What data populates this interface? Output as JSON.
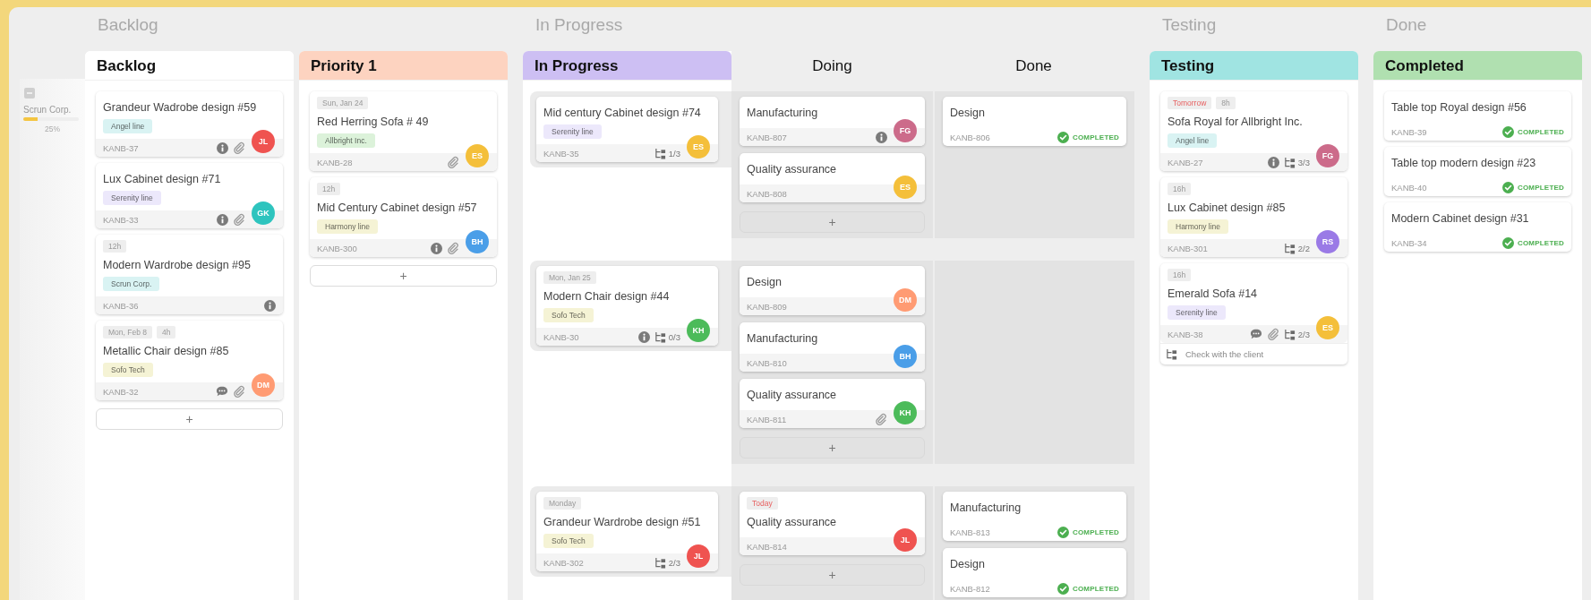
{
  "lane": {
    "title": "Scrun Corp.",
    "expanded": true,
    "level": 0.25,
    "percent": "25%"
  },
  "groups": [
    {
      "title": "Backlog",
      "kind": "columns",
      "columns": [
        {
          "title": "Backlog",
          "color": "#ffffff",
          "add": "+",
          "cards": [
            {
              "title": "Grandeur Wadrobe design #59",
              "label": {
                "text": "Angel line",
                "color": "#d9f3f3"
              },
              "id": "KANB-37",
              "info": true,
              "attachment": true,
              "avatar": {
                "initials": "JL",
                "color": "#ef5350"
              }
            },
            {
              "title": "Lux Cabinet design #71",
              "label": {
                "text": "Serenity line",
                "color": "#ece8fb"
              },
              "id": "KANB-33",
              "info": true,
              "attachment": true,
              "avatar": {
                "initials": "GK",
                "color": "#2ec4be"
              }
            },
            {
              "chips": [
                {
                  "text": "12h",
                  "kind": "date"
                }
              ],
              "title": "Modern Wardrobe design #95",
              "label": {
                "text": "Scrun Corp.",
                "color": "#d9f3f3"
              },
              "id": "KANB-36",
              "info": true
            },
            {
              "chips": [
                {
                  "text": "Mon, Feb 8",
                  "kind": "date"
                },
                {
                  "text": "4h",
                  "kind": "date"
                }
              ],
              "title": "Metallic Chair design #85",
              "label": {
                "text": "Sofo Tech",
                "color": "#f5f3d5"
              },
              "id": "KANB-32",
              "comment": true,
              "attachment": true,
              "avatar": {
                "initials": "DM",
                "color": "#ff9b73"
              }
            }
          ]
        },
        {
          "title": "Priority 1",
          "color": "#fdd3c0",
          "add": "+",
          "cards": [
            {
              "chips": [
                {
                  "text": "Sun, Jan 24",
                  "kind": "date"
                }
              ],
              "title": "Red Herring Sofa # 49",
              "label": {
                "text": "Allbright Inc.",
                "color": "#dcf2da"
              },
              "id": "KANB-28",
              "attachment": true,
              "avatar": {
                "initials": "ES",
                "color": "#f4bf3a"
              }
            },
            {
              "chips": [
                {
                  "text": "12h",
                  "kind": "date"
                }
              ],
              "title": "Mid Century Cabinet design #57",
              "label": {
                "text": "Harmony line",
                "color": "#f5f3d5"
              },
              "id": "KANB-300",
              "info": true,
              "attachment": true,
              "avatar": {
                "initials": "BH",
                "color": "#4a9ee8"
              }
            }
          ]
        }
      ]
    },
    {
      "title": "In Progress",
      "kind": "swimlanes",
      "column": {
        "title": "In Progress",
        "color": "#cdbff3"
      },
      "subcolumns": [
        {
          "title": "Doing"
        },
        {
          "title": "Done"
        }
      ],
      "rows": [
        {
          "card": {
            "title": "Mid century Cabinet design #74",
            "label": {
              "text": "Serenity line",
              "color": "#ece8fb"
            },
            "id": "KANB-35",
            "subtasks": "1/3",
            "avatar": {
              "initials": "ES",
              "color": "#f4bf3a"
            }
          },
          "cells": [
            {
              "add": "+",
              "cards": [
                {
                  "title": "Manufacturing",
                  "id": "KANB-807",
                  "info": true,
                  "avatar": {
                    "initials": "FG",
                    "color": "#cc6b8a"
                  }
                },
                {
                  "title": "Quality assurance",
                  "id": "KANB-808",
                  "avatar": {
                    "initials": "ES",
                    "color": "#f4bf3a"
                  }
                }
              ]
            },
            {
              "cards": [
                {
                  "title": "Design",
                  "id": "KANB-806",
                  "status": "COMPLETED"
                }
              ]
            }
          ]
        },
        {
          "card": {
            "chips": [
              {
                "text": "Mon, Jan 25",
                "kind": "date"
              }
            ],
            "title": "Modern Chair design #44",
            "label": {
              "text": "Sofo Tech",
              "color": "#f5f3d5"
            },
            "id": "KANB-30",
            "info": true,
            "subtasks": "0/3",
            "avatar": {
              "initials": "KH",
              "color": "#4cbb5a"
            }
          },
          "cells": [
            {
              "add": "+",
              "cards": [
                {
                  "title": "Design",
                  "id": "KANB-809",
                  "avatar": {
                    "initials": "DM",
                    "color": "#ff9b73"
                  }
                },
                {
                  "title": "Manufacturing",
                  "id": "KANB-810",
                  "avatar": {
                    "initials": "BH",
                    "color": "#4a9ee8"
                  }
                },
                {
                  "title": "Quality assurance",
                  "id": "KANB-811",
                  "attachment": true,
                  "avatar": {
                    "initials": "KH",
                    "color": "#4cbb5a"
                  }
                }
              ]
            },
            {}
          ]
        },
        {
          "card": {
            "chips": [
              {
                "text": "Monday",
                "kind": "date"
              }
            ],
            "title": "Grandeur Wardrobe design #51",
            "label": {
              "text": "Sofo Tech",
              "color": "#f5f3d5"
            },
            "id": "KANB-302",
            "subtasks": "2/3",
            "avatar": {
              "initials": "JL",
              "color": "#ef5350"
            }
          },
          "cells": [
            {
              "add": "+",
              "cards": [
                {
                  "chips": [
                    {
                      "text": "Today",
                      "kind": "due"
                    }
                  ],
                  "title": "Quality assurance",
                  "id": "KANB-814",
                  "avatar": {
                    "initials": "JL",
                    "color": "#ef5350"
                  }
                }
              ]
            },
            {
              "cards": [
                {
                  "title": "Manufacturing",
                  "id": "KANB-813",
                  "status": "COMPLETED"
                },
                {
                  "title": "Design",
                  "id": "KANB-812",
                  "status": "COMPLETED"
                }
              ]
            }
          ]
        }
      ]
    },
    {
      "title": "Testing",
      "kind": "columns",
      "columns": [
        {
          "title": "Testing",
          "color": "#a0e4e2",
          "cards": [
            {
              "chips": [
                {
                  "text": "Tomorrow",
                  "kind": "due"
                },
                {
                  "text": "8h",
                  "kind": "date"
                }
              ],
              "title": "Sofa Royal for Allbright Inc.",
              "label": {
                "text": "Angel line",
                "color": "#d9f3f3"
              },
              "id": "KANB-27",
              "info": true,
              "subtasks": "3/3",
              "avatar": {
                "initials": "FG",
                "color": "#cc6b8a"
              }
            },
            {
              "chips": [
                {
                  "text": "16h",
                  "kind": "date"
                }
              ],
              "title": "Lux Cabinet design #85",
              "label": {
                "text": "Harmony line",
                "color": "#f5f3d5"
              },
              "id": "KANB-301",
              "subtasks": "2/2",
              "avatar": {
                "initials": "RS",
                "color": "#9a7ae6"
              }
            },
            {
              "chips": [
                {
                  "text": "16h",
                  "kind": "date"
                }
              ],
              "title": "Emerald Sofa #14",
              "label": {
                "text": "Serenity line",
                "color": "#ece8fb"
              },
              "id": "KANB-38",
              "comment": true,
              "attachment": true,
              "subtasks": "2/3",
              "avatar": {
                "initials": "ES",
                "color": "#f4bf3a"
              },
              "checklist": [
                "Check with the client"
              ]
            }
          ]
        }
      ]
    },
    {
      "title": "Done",
      "kind": "columns",
      "columns": [
        {
          "title": "Completed",
          "color": "#b0e0b0",
          "cards": [
            {
              "title": "Table top Royal design #56",
              "id": "KANB-39",
              "status": "COMPLETED"
            },
            {
              "title": "Table top modern design #23",
              "id": "KANB-40",
              "status": "COMPLETED"
            },
            {
              "title": "Modern Cabinet design #31",
              "id": "KANB-34",
              "status": "COMPLETED"
            }
          ]
        }
      ]
    }
  ]
}
